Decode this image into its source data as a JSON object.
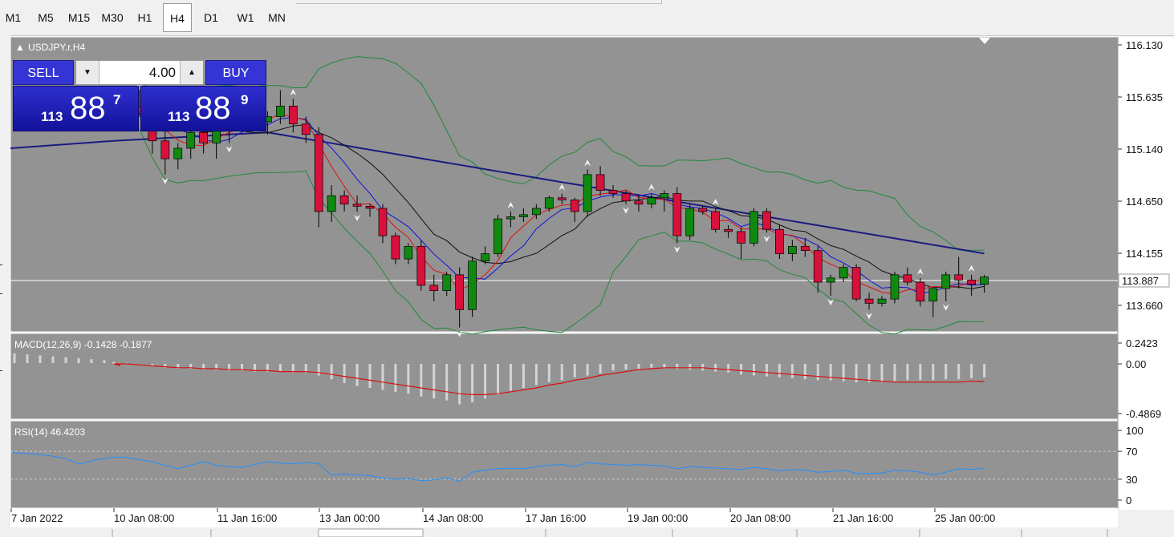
{
  "timeframes": [
    {
      "label": "M1",
      "active": false
    },
    {
      "label": "M5",
      "active": false
    },
    {
      "label": "M15",
      "active": false
    },
    {
      "label": "M30",
      "active": false
    },
    {
      "label": "H1",
      "active": false
    },
    {
      "label": "H4",
      "active": true
    },
    {
      "label": "D1",
      "active": false
    },
    {
      "label": "W1",
      "active": false
    },
    {
      "label": "MN",
      "active": false
    }
  ],
  "chart": {
    "symbol_label": "USDJPY.r,H4",
    "current_price": "113.887",
    "price_ticks": [
      "116.130",
      "115.635",
      "115.140",
      "114.650",
      "114.155",
      "113.660"
    ],
    "time_labels": [
      "7 Jan 2022",
      "10 Jan 08:00",
      "11 Jan 16:00",
      "13 Jan 00:00",
      "14 Jan 08:00",
      "17 Jan 16:00",
      "19 Jan 00:00",
      "20 Jan 08:00",
      "21 Jan 16:00",
      "25 Jan 00:00"
    ],
    "colors": {
      "background": "#939393",
      "bull": "#0f8a0f",
      "bear": "#d8103c",
      "ma_long": "#1a1a80",
      "ma_fast": "#e01010",
      "ma_mid": "#1010e0",
      "ma_slow": "#101010",
      "bands": "#1f8a3a",
      "macd_signal": "#d81010",
      "macd_hist": "#d4d4d4",
      "rsi": "#1e90ff"
    }
  },
  "trade_panel": {
    "sell_label": "SELL",
    "buy_label": "BUY",
    "lot": "4.00",
    "down_arrow": "▼",
    "up_arrow": "▲",
    "sell_price": {
      "prefix": "113",
      "big": "88",
      "sup": "7"
    },
    "buy_price": {
      "prefix": "113",
      "big": "88",
      "sup": "9"
    }
  },
  "macd": {
    "label": "MACD(12,26,9) -0.1428 -0.1877",
    "ticks": [
      "0.2423",
      "0.00",
      "-0.4869"
    ]
  },
  "rsi": {
    "label": "RSI(14) 46.4203",
    "ticks": [
      "100",
      "70",
      "30",
      "0"
    ]
  },
  "chart_data": {
    "type": "candlestick",
    "symbol": "USDJPY.r",
    "timeframe": "H4",
    "ylim": [
      113.5,
      116.2
    ],
    "candles": [
      [
        115.45,
        115.6,
        115.38,
        115.5
      ],
      [
        115.5,
        115.62,
        115.42,
        115.55
      ],
      [
        115.55,
        115.7,
        115.45,
        115.48
      ],
      [
        115.48,
        115.55,
        115.1,
        115.22
      ],
      [
        115.22,
        115.35,
        114.9,
        115.05
      ],
      [
        115.05,
        115.2,
        114.95,
        115.15
      ],
      [
        115.15,
        115.35,
        115.05,
        115.3
      ],
      [
        115.3,
        115.45,
        115.1,
        115.2
      ],
      [
        115.2,
        115.4,
        115.05,
        115.32
      ],
      [
        115.32,
        115.45,
        115.2,
        115.38
      ],
      [
        115.38,
        115.6,
        115.3,
        115.48
      ],
      [
        115.48,
        115.55,
        115.35,
        115.4
      ],
      [
        115.4,
        115.5,
        115.28,
        115.45
      ],
      [
        115.45,
        115.7,
        115.38,
        115.55
      ],
      [
        115.55,
        115.62,
        115.3,
        115.38
      ],
      [
        115.38,
        115.45,
        115.2,
        115.28
      ],
      [
        115.28,
        115.35,
        114.4,
        114.55
      ],
      [
        114.55,
        114.8,
        114.45,
        114.7
      ],
      [
        114.7,
        114.75,
        114.55,
        114.62
      ],
      [
        114.62,
        114.7,
        114.55,
        114.6
      ],
      [
        114.6,
        114.62,
        114.5,
        114.58
      ],
      [
        114.58,
        114.62,
        114.25,
        114.32
      ],
      [
        114.32,
        114.35,
        114.05,
        114.1
      ],
      [
        114.1,
        114.25,
        114.05,
        114.22
      ],
      [
        114.22,
        114.28,
        113.8,
        113.85
      ],
      [
        113.85,
        113.95,
        113.7,
        113.8
      ],
      [
        113.8,
        113.98,
        113.75,
        113.95
      ],
      [
        113.95,
        114.02,
        113.45,
        113.62
      ],
      [
        113.62,
        114.12,
        113.55,
        114.08
      ],
      [
        114.08,
        114.22,
        114.05,
        114.15
      ],
      [
        114.15,
        114.52,
        114.12,
        114.48
      ],
      [
        114.48,
        114.55,
        114.4,
        114.5
      ],
      [
        114.5,
        114.58,
        114.45,
        114.52
      ],
      [
        114.52,
        114.62,
        114.48,
        114.58
      ],
      [
        114.58,
        114.7,
        114.55,
        114.68
      ],
      [
        114.68,
        114.72,
        114.62,
        114.66
      ],
      [
        114.66,
        114.68,
        114.45,
        114.55
      ],
      [
        114.55,
        114.95,
        114.5,
        114.9
      ],
      [
        114.9,
        114.98,
        114.7,
        114.75
      ],
      [
        114.75,
        114.8,
        114.68,
        114.72
      ],
      [
        114.72,
        114.75,
        114.62,
        114.65
      ],
      [
        114.65,
        114.7,
        114.55,
        114.62
      ],
      [
        114.62,
        114.72,
        114.58,
        114.68
      ],
      [
        114.68,
        114.75,
        114.55,
        114.72
      ],
      [
        114.72,
        114.78,
        114.25,
        114.32
      ],
      [
        114.32,
        114.62,
        114.28,
        114.58
      ],
      [
        114.58,
        114.6,
        114.52,
        114.55
      ],
      [
        114.55,
        114.58,
        114.35,
        114.38
      ],
      [
        114.38,
        114.42,
        114.3,
        114.36
      ],
      [
        114.36,
        114.4,
        114.1,
        114.25
      ],
      [
        114.25,
        114.58,
        114.22,
        114.55
      ],
      [
        114.55,
        114.58,
        114.35,
        114.38
      ],
      [
        114.38,
        114.42,
        114.1,
        114.15
      ],
      [
        114.15,
        114.28,
        114.08,
        114.22
      ],
      [
        114.22,
        114.3,
        114.12,
        114.18
      ],
      [
        114.18,
        114.22,
        113.78,
        113.88
      ],
      [
        113.88,
        113.95,
        113.75,
        113.92
      ],
      [
        113.92,
        114.05,
        113.88,
        114.02
      ],
      [
        114.02,
        114.05,
        113.7,
        113.72
      ],
      [
        113.72,
        113.78,
        113.62,
        113.68
      ],
      [
        113.68,
        113.75,
        113.65,
        113.72
      ],
      [
        113.72,
        113.98,
        113.68,
        113.95
      ],
      [
        113.95,
        114.02,
        113.85,
        113.88
      ],
      [
        113.88,
        113.92,
        113.65,
        113.7
      ],
      [
        113.7,
        113.82,
        113.55,
        113.82
      ],
      [
        113.82,
        113.98,
        113.7,
        113.95
      ],
      [
        113.95,
        114.12,
        113.82,
        113.9
      ],
      [
        113.9,
        113.95,
        113.75,
        113.86
      ],
      [
        113.86,
        113.95,
        113.78,
        113.93
      ]
    ],
    "macd": {
      "histogram": [
        0.02,
        0.01,
        0.0,
        -0.02,
        -0.04,
        -0.05,
        -0.05,
        -0.06,
        -0.06,
        -0.07,
        -0.07,
        -0.08,
        -0.08,
        -0.08,
        -0.09,
        -0.09,
        -0.12,
        -0.16,
        -0.2,
        -0.23,
        -0.25,
        -0.27,
        -0.29,
        -0.31,
        -0.34,
        -0.36,
        -0.38,
        -0.42,
        -0.4,
        -0.36,
        -0.32,
        -0.28,
        -0.25,
        -0.22,
        -0.19,
        -0.17,
        -0.14,
        -0.12,
        -0.1,
        -0.07,
        -0.06,
        -0.05,
        -0.04,
        -0.04,
        -0.05,
        -0.06,
        -0.07,
        -0.08,
        -0.09,
        -0.11,
        -0.12,
        -0.13,
        -0.14,
        -0.15,
        -0.16,
        -0.17,
        -0.17,
        -0.18,
        -0.19,
        -0.19,
        -0.19,
        -0.18,
        -0.17,
        -0.17,
        -0.17,
        -0.16,
        -0.16,
        -0.15,
        -0.14
      ],
      "signal": [
        0.0,
        0.0,
        -0.01,
        -0.02,
        -0.03,
        -0.04,
        -0.04,
        -0.05,
        -0.05,
        -0.06,
        -0.06,
        -0.07,
        -0.07,
        -0.08,
        -0.08,
        -0.08,
        -0.09,
        -0.11,
        -0.13,
        -0.15,
        -0.17,
        -0.19,
        -0.21,
        -0.23,
        -0.25,
        -0.27,
        -0.29,
        -0.31,
        -0.32,
        -0.32,
        -0.31,
        -0.29,
        -0.27,
        -0.25,
        -0.22,
        -0.2,
        -0.17,
        -0.15,
        -0.12,
        -0.1,
        -0.08,
        -0.06,
        -0.05,
        -0.04,
        -0.04,
        -0.04,
        -0.04,
        -0.05,
        -0.06,
        -0.07,
        -0.08,
        -0.09,
        -0.1,
        -0.11,
        -0.12,
        -0.13,
        -0.14,
        -0.15,
        -0.16,
        -0.17,
        -0.18,
        -0.19,
        -0.19,
        -0.19,
        -0.19,
        -0.19,
        -0.19,
        -0.18,
        -0.18
      ]
    },
    "rsi": [
      62,
      61,
      58,
      55,
      50,
      45,
      50,
      55,
      50,
      48,
      47,
      51,
      55,
      53,
      52,
      54,
      52,
      36,
      37,
      36,
      35,
      32,
      30,
      31,
      28,
      29,
      32,
      27,
      40,
      43,
      45,
      46,
      45,
      48,
      50,
      51,
      48,
      54,
      52,
      51,
      50,
      51,
      50,
      49,
      45,
      48,
      47,
      46,
      45,
      44,
      47,
      45,
      42,
      44,
      43,
      40,
      41,
      43,
      38,
      38,
      39,
      43,
      42,
      40,
      36,
      40,
      45,
      44,
      46
    ]
  }
}
